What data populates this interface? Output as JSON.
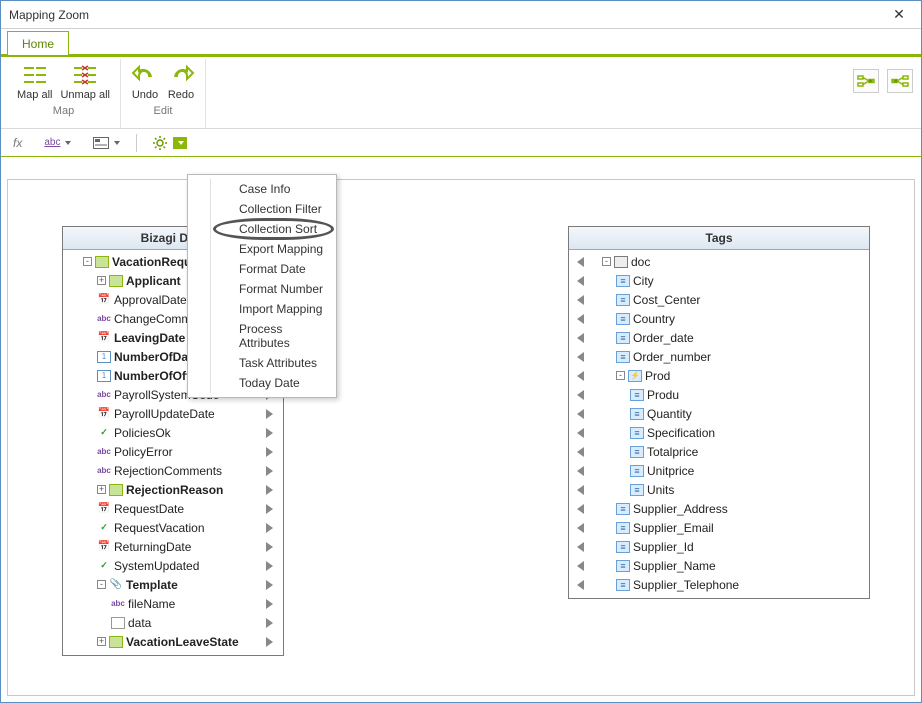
{
  "window": {
    "title": "Mapping Zoom"
  },
  "tabs": {
    "home": "Home"
  },
  "ribbon": {
    "map_all": "Map all",
    "unmap_all": "Unmap all",
    "undo": "Undo",
    "redo": "Redo",
    "group_map": "Map",
    "group_edit": "Edit"
  },
  "toolbar": {
    "fx_label": "fx",
    "abc_label": "abc"
  },
  "dropdown": {
    "items": [
      "Case Info",
      "Collection Filter",
      "Collection Sort",
      "Export Mapping",
      "Format Date",
      "Format Number",
      "Import Mapping",
      "Process Attributes",
      "Task Attributes",
      "Today Date"
    ],
    "highlight_index": 2
  },
  "source": {
    "title": "Bizagi Data",
    "rows": [
      {
        "indent": 0,
        "expander": "-",
        "icon": "entity",
        "label": "VacationRequ",
        "bold": true,
        "tri": true
      },
      {
        "indent": 1,
        "expander": "+",
        "icon": "entity",
        "label": "Applicant",
        "bold": true,
        "tri": true
      },
      {
        "indent": 1,
        "icon": "date",
        "label": "ApprovalDate",
        "tri": true,
        "cut": true
      },
      {
        "indent": 1,
        "icon": "text",
        "label": "ChangeComm",
        "tri": true,
        "cut": true
      },
      {
        "indent": 1,
        "icon": "date",
        "label": "LeavingDate",
        "bold": true,
        "tri": true
      },
      {
        "indent": 1,
        "icon": "num",
        "label": "NumberOfDa",
        "bold": true,
        "tri": true,
        "cut": true
      },
      {
        "indent": 1,
        "icon": "num",
        "label": "NumberOfOff",
        "bold": true,
        "tri": true,
        "cut": true
      },
      {
        "indent": 1,
        "icon": "text",
        "label": "PayrollSystemCode",
        "tri": true
      },
      {
        "indent": 1,
        "icon": "date",
        "label": "PayrollUpdateDate",
        "tri": true
      },
      {
        "indent": 1,
        "icon": "check",
        "label": "PoliciesOk",
        "tri": true
      },
      {
        "indent": 1,
        "icon": "text",
        "label": "PolicyError",
        "tri": true
      },
      {
        "indent": 1,
        "icon": "text",
        "label": "RejectionComments",
        "tri": true
      },
      {
        "indent": 1,
        "expander": "+",
        "icon": "entity",
        "label": "RejectionReason",
        "bold": true,
        "tri": true
      },
      {
        "indent": 1,
        "icon": "date",
        "label": "RequestDate",
        "tri": true
      },
      {
        "indent": 1,
        "icon": "check",
        "label": "RequestVacation",
        "tri": true
      },
      {
        "indent": 1,
        "icon": "date",
        "label": "ReturningDate",
        "tri": true
      },
      {
        "indent": 1,
        "icon": "check",
        "label": "SystemUpdated",
        "tri": true
      },
      {
        "indent": 1,
        "expander": "-",
        "icon": "clip",
        "label": "Template",
        "bold": true,
        "tri": true
      },
      {
        "indent": 2,
        "icon": "text",
        "label": "fileName",
        "tri": true
      },
      {
        "indent": 2,
        "icon": "file",
        "label": "data",
        "tri": true
      },
      {
        "indent": 1,
        "expander": "+",
        "icon": "entity",
        "label": "VacationLeaveState",
        "bold": true,
        "tri": true
      }
    ]
  },
  "target": {
    "title": "Tags",
    "rows": [
      {
        "indent": 0,
        "tri": true,
        "expander": "-",
        "icon": "box",
        "label": "doc"
      },
      {
        "indent": 1,
        "tri": true,
        "icon": "tag",
        "label": "City"
      },
      {
        "indent": 1,
        "tri": true,
        "icon": "tag",
        "label": "Cost_Center"
      },
      {
        "indent": 1,
        "tri": true,
        "icon": "tag",
        "label": "Country"
      },
      {
        "indent": 1,
        "tri": true,
        "icon": "tag",
        "label": "Order_date"
      },
      {
        "indent": 1,
        "tri": true,
        "icon": "tag",
        "label": "Order_number"
      },
      {
        "indent": 1,
        "tri": true,
        "expander": "-",
        "icon": "tagevent",
        "label": "Prod"
      },
      {
        "indent": 2,
        "tri": true,
        "icon": "tag",
        "label": "Produ"
      },
      {
        "indent": 2,
        "tri": true,
        "icon": "tag",
        "label": "Quantity"
      },
      {
        "indent": 2,
        "tri": true,
        "icon": "tag",
        "label": "Specification"
      },
      {
        "indent": 2,
        "tri": true,
        "icon": "tag",
        "label": "Totalprice"
      },
      {
        "indent": 2,
        "tri": true,
        "icon": "tag",
        "label": "Unitprice"
      },
      {
        "indent": 2,
        "tri": true,
        "icon": "tag",
        "label": "Units"
      },
      {
        "indent": 1,
        "tri": true,
        "icon": "tag",
        "label": "Supplier_Address"
      },
      {
        "indent": 1,
        "tri": true,
        "icon": "tag",
        "label": "Supplier_Email"
      },
      {
        "indent": 1,
        "tri": true,
        "icon": "tag",
        "label": "Supplier_Id"
      },
      {
        "indent": 1,
        "tri": true,
        "icon": "tag",
        "label": "Supplier_Name"
      },
      {
        "indent": 1,
        "tri": true,
        "icon": "tag",
        "label": "Supplier_Telephone"
      }
    ]
  }
}
